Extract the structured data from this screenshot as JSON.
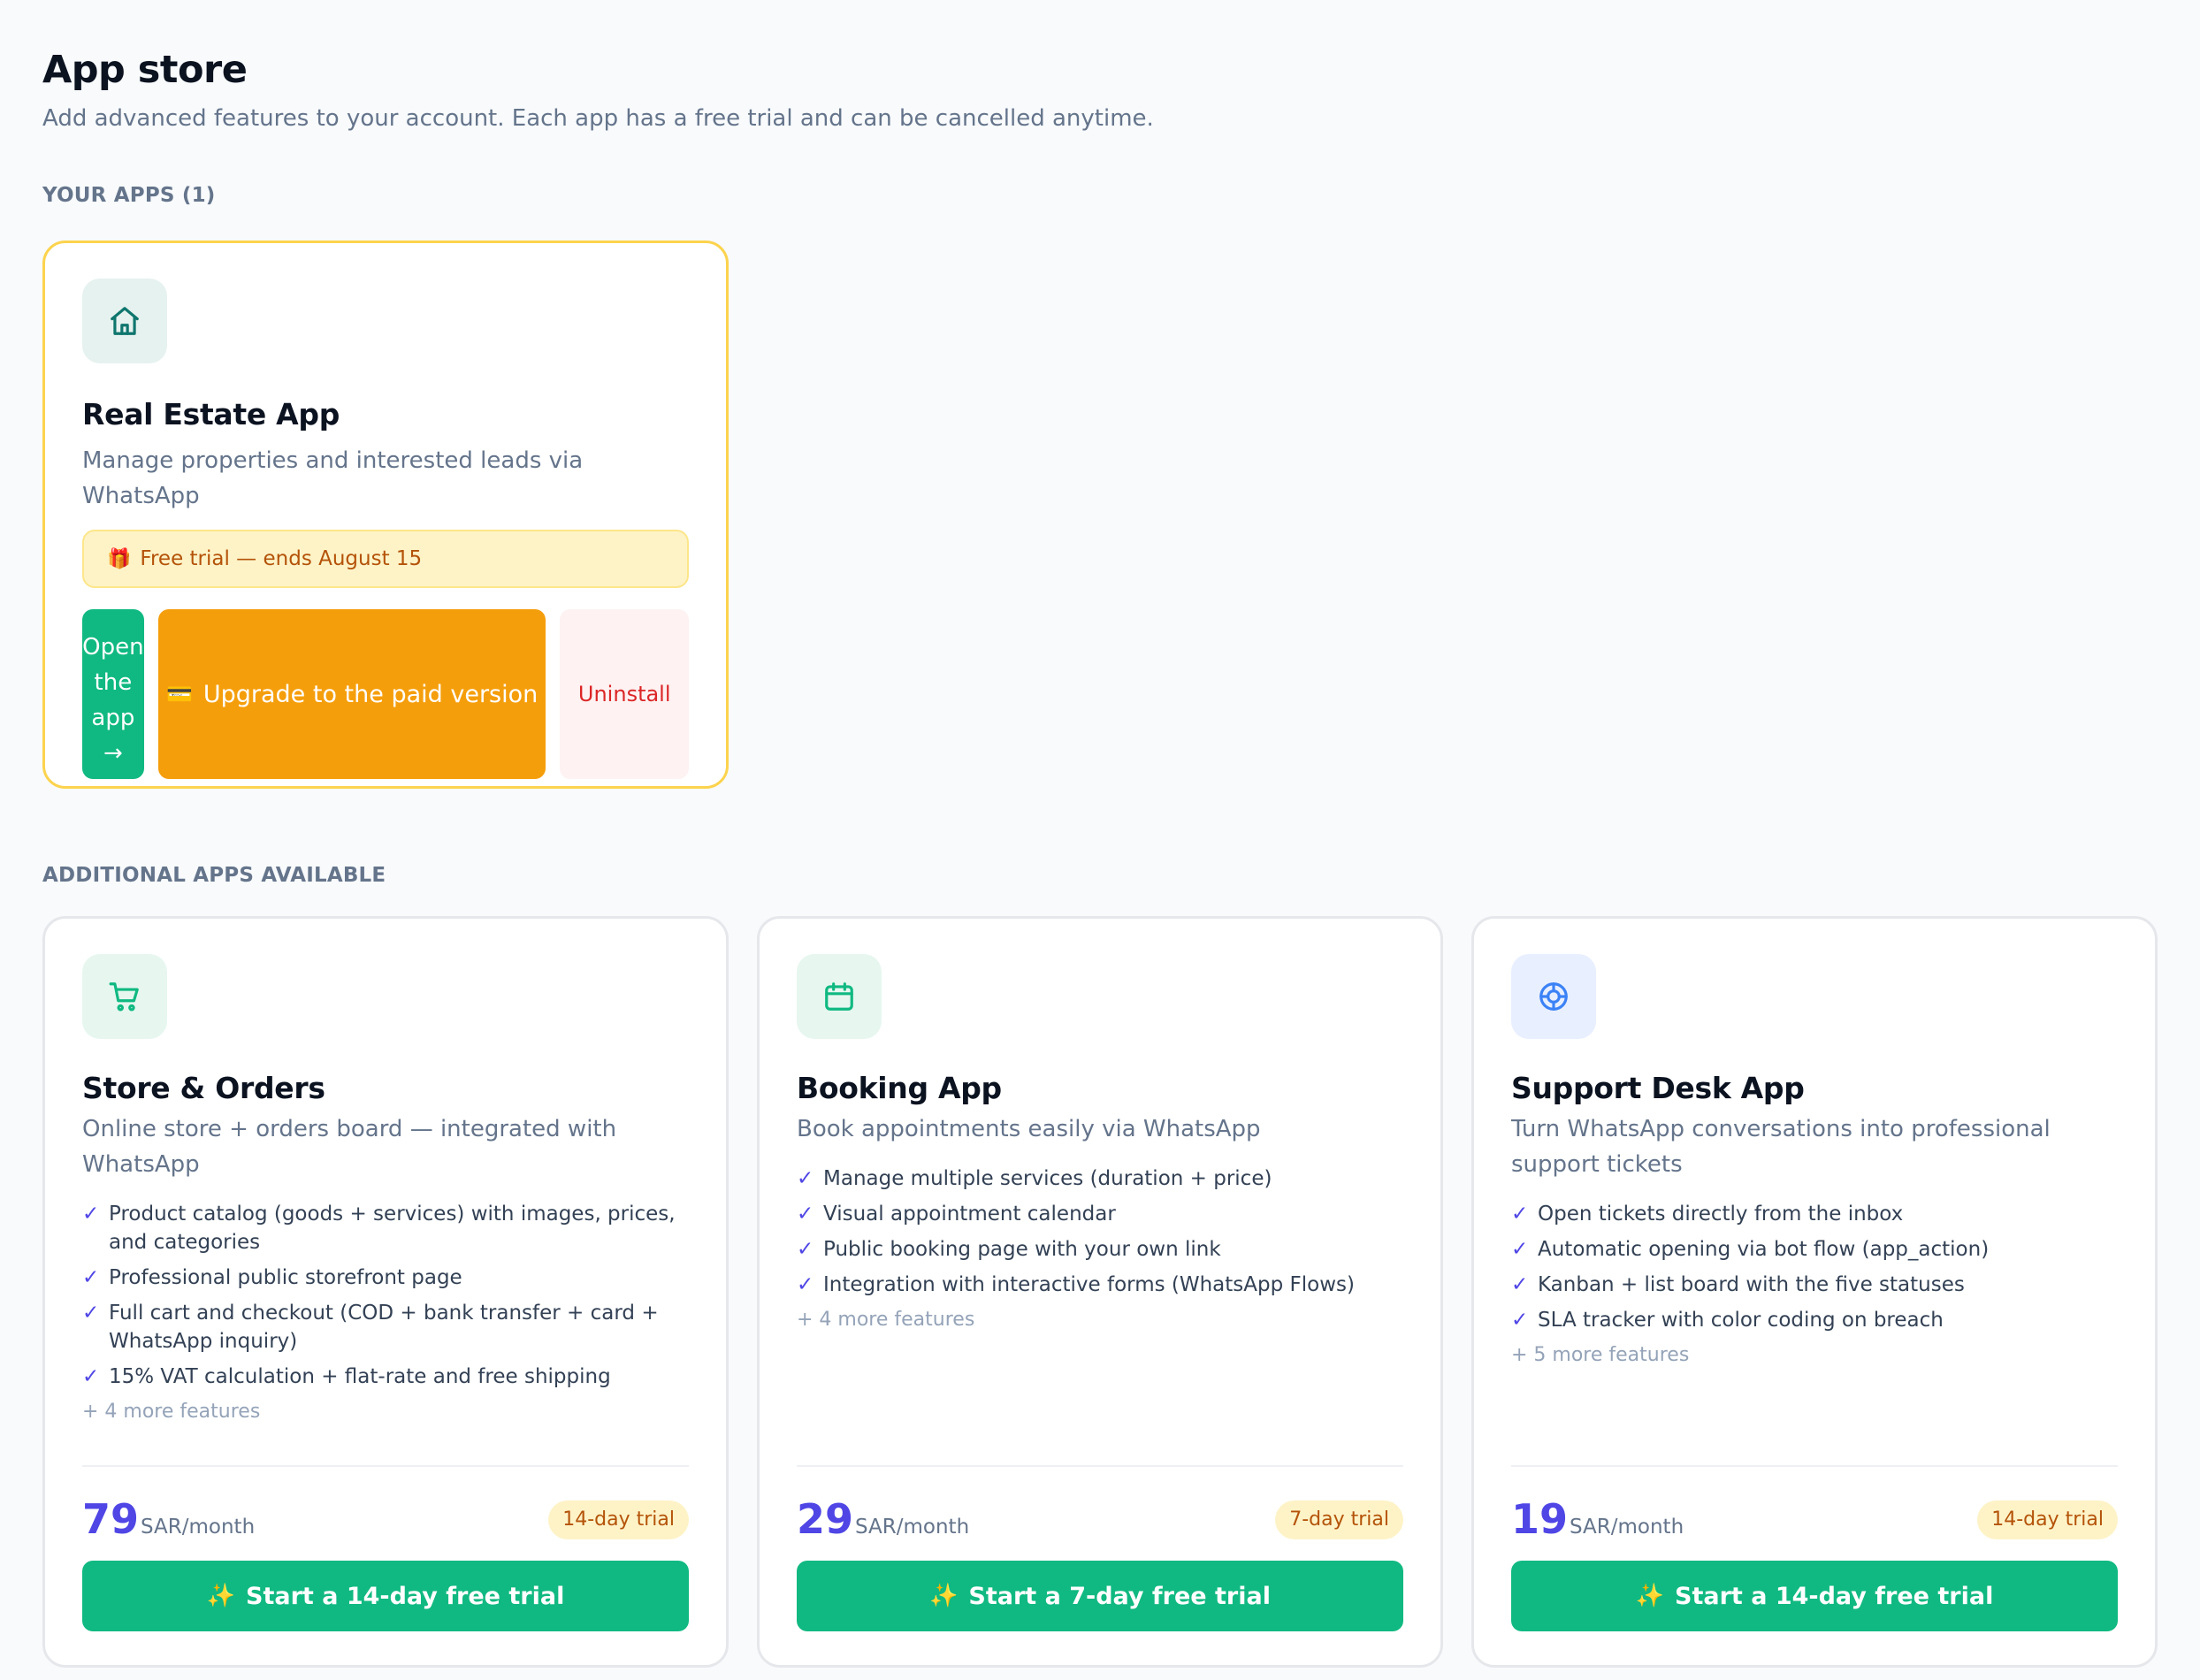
{
  "header": {
    "title": "App store",
    "subtitle": "Add advanced features to your account. Each app has a free trial and can be cancelled anytime."
  },
  "sections": {
    "your_apps": "YOUR APPS (1)",
    "additional": "ADDITIONAL APPS AVAILABLE"
  },
  "installed": {
    "icon": "home-icon",
    "name": "Real Estate App",
    "description": "Manage properties and interested leads via WhatsApp",
    "trial_banner_emoji": "🎁",
    "trial_banner": "Free trial — ends August 15",
    "open_label_1": "Open",
    "open_label_2": "the",
    "open_label_3": "app",
    "open_label_4": "→",
    "upgrade_emoji": "💳",
    "upgrade_label": "Upgrade to the paid version",
    "uninstall_label": "Uninstall"
  },
  "apps": [
    {
      "icon": "shopping-cart-icon",
      "name": "Store & Orders",
      "description": "Online store + orders board — integrated with WhatsApp",
      "features": [
        "Product catalog (goods + services) with images, prices, and categories",
        "Professional public storefront page",
        "Full cart and checkout (COD + bank transfer + card + WhatsApp inquiry)",
        "15% VAT calculation + flat-rate and free shipping"
      ],
      "more": "+ 4 more features",
      "price": "79",
      "unit": "SAR/month",
      "trial_pill": "14-day trial",
      "cta_emoji": "✨",
      "cta": "Start a 14-day free trial"
    },
    {
      "icon": "calendar-icon",
      "name": "Booking App",
      "description": "Book appointments easily via WhatsApp",
      "features": [
        "Manage multiple services (duration + price)",
        "Visual appointment calendar",
        "Public booking page with your own link",
        "Integration with interactive forms (WhatsApp Flows)"
      ],
      "more": "+ 4 more features",
      "price": "29",
      "unit": "SAR/month",
      "trial_pill": "7-day trial",
      "cta_emoji": "✨",
      "cta": "Start a 7-day free trial"
    },
    {
      "icon": "lifebuoy-icon",
      "name": "Support Desk App",
      "description": "Turn WhatsApp conversations into professional support tickets",
      "features": [
        "Open tickets directly from the inbox",
        "Automatic opening via bot flow (app_action)",
        "Kanban + list board with the five statuses",
        "SLA tracker with color coding on breach"
      ],
      "more": "+ 5 more features",
      "price": "19",
      "unit": "SAR/month",
      "trial_pill": "14-day trial",
      "cta_emoji": "✨",
      "cta": "Start a 14-day free trial"
    }
  ],
  "check_glyph": "✓",
  "colors": {
    "primary_green": "#10b981",
    "accent_indigo": "#4f46e5",
    "upgrade_orange": "#f59e0b",
    "danger_red": "#dc2626",
    "installed_border": "#fcd34d"
  }
}
